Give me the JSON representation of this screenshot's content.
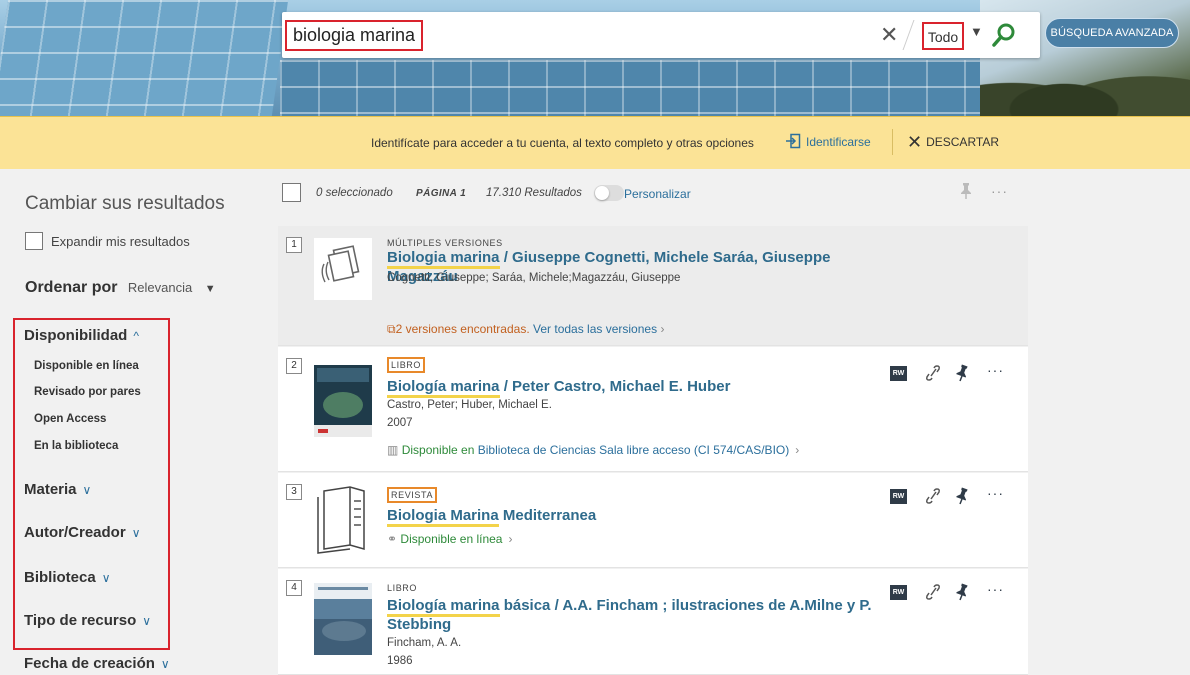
{
  "search": {
    "query": "biologia marina",
    "scope": "Todo",
    "advanced_label": "BÚSQUEDA AVANZADA"
  },
  "banner": {
    "message": "Identifícate para acceder a tu cuenta, al texto completo y otras opciones",
    "login_label": "Identificarse",
    "dismiss_label": "DESCARTAR"
  },
  "facets": {
    "title": "Cambiar sus resultados",
    "expand_label": "Expandir mis resultados",
    "sort_label": "Ordenar por",
    "sort_value": "Relevancia",
    "groups": [
      {
        "label": "Disponibilidad",
        "expanded": true
      },
      {
        "label": "Materia"
      },
      {
        "label": "Autor/Creador"
      },
      {
        "label": "Biblioteca"
      },
      {
        "label": "Tipo de recurso"
      },
      {
        "label": "Fecha de creación"
      }
    ],
    "availability_items": [
      "Disponible en línea",
      "Revisado por pares",
      "Open Access",
      "En la biblioteca"
    ]
  },
  "toolbar": {
    "selected": "0 seleccionado",
    "page": "PÁGINA 1",
    "results": "17.310 Resultados",
    "personalize": "Personalizar"
  },
  "results": [
    {
      "rank": "1",
      "type": "MÚLTIPLES VERSIONES",
      "title_hl": "Biologia marina",
      "title_rest": " / Giuseppe Cognetti, Michele Saráa, Giuseppe Magazzáu",
      "authors": "Cognetti, Giuseppe; Saráa, Michele;Magazzáu, Giuseppe",
      "versions_count": "2 versiones encontradas.",
      "versions_link": "Ver todas las versiones"
    },
    {
      "rank": "2",
      "type": "LIBRO",
      "title_hl": "Biología marina",
      "title_rest": " / Peter Castro, Michael E. Huber",
      "authors": "Castro, Peter; Huber, Michael E.",
      "year": "2007",
      "avail_prefix": "Disponible en",
      "avail_location": "Biblioteca de Ciencias  Sala libre acceso (CI 574/CAS/BIO)"
    },
    {
      "rank": "3",
      "type": "REVISTA",
      "title_hl": "Biologia Marina",
      "title_rest": " Mediterranea",
      "avail_online": "Disponible en línea"
    },
    {
      "rank": "4",
      "type": "LIBRO",
      "title_hl": "Biología marina",
      "title_rest": " básica / A.A. Fincham ; ilustraciones de A.Milne y P. Stebbing",
      "authors": "Fincham, A. A.",
      "year": "1986"
    }
  ],
  "actions": {
    "rw": "RW"
  }
}
